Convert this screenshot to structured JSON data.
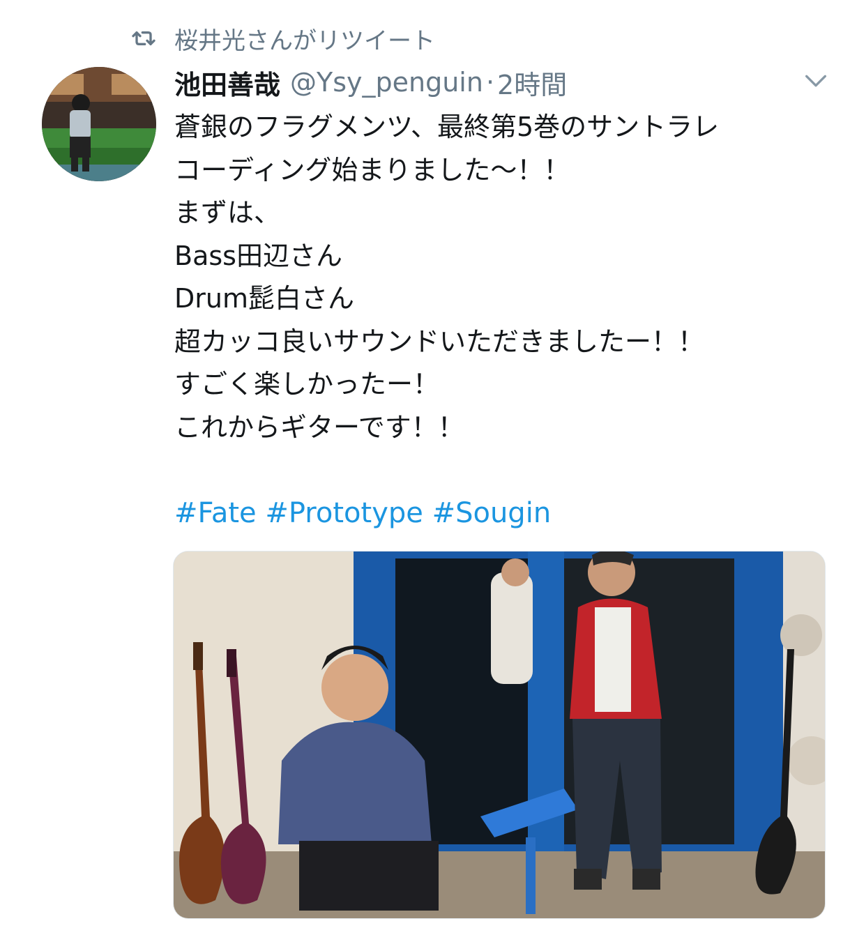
{
  "retweet": {
    "icon": "retweet-icon",
    "text": "桜井光さんがリツイート"
  },
  "tweet": {
    "display_name": "池田善哉",
    "handle": "@Ysy_penguin",
    "separator": "·",
    "time": "2時間",
    "body_lines": [
      "蒼銀のフラグメンツ、最終第5巻のサントラレ",
      "コーディング始まりました〜！！",
      "まずは、",
      "Bass田辺さん",
      "Drum髭白さん",
      "超カッコ良いサウンドいただきましたー！！",
      "すごく楽しかったー！",
      "これからギターです！！"
    ],
    "hashtags": [
      "#Fate",
      "#Prototype",
      "#Sougin"
    ]
  },
  "icons": {
    "retweet": "retweet-icon",
    "more": "chevron-down-icon"
  },
  "colors": {
    "secondary_text": "#657786",
    "hashtag": "#1b95e0",
    "primary_text": "#14171a"
  }
}
